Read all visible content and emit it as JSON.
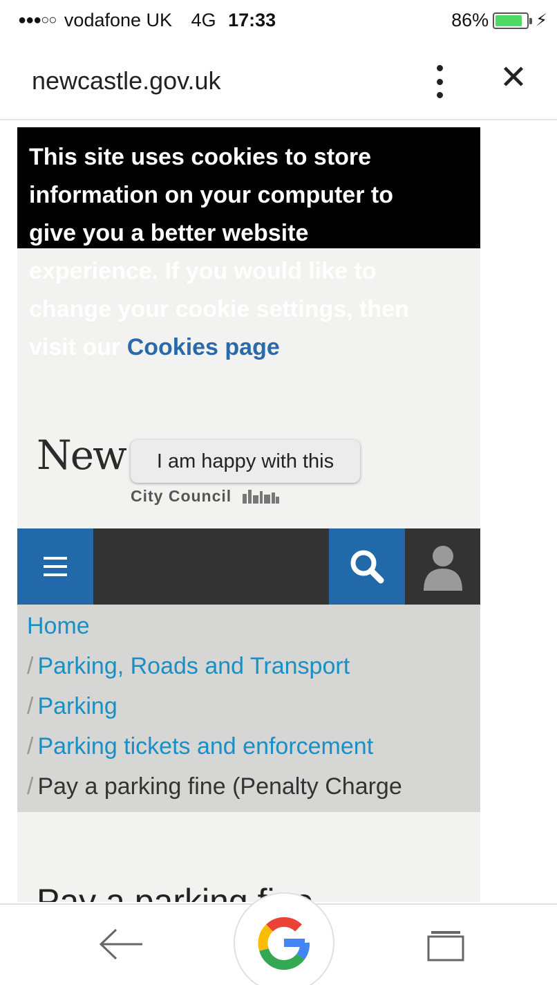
{
  "status_bar": {
    "signal": "●●●○○",
    "carrier": "vodafone UK",
    "network": "4G",
    "time": "17:33",
    "battery": "86%",
    "battery_level": 0.86,
    "battery_color": "#4cd964"
  },
  "browser": {
    "url": "newcastle.gov.uk",
    "menu_icon": "vertical-dots-icon",
    "close_icon": "close-icon"
  },
  "cookie_banner": {
    "text": "This site uses cookies to store information on your computer to give you a better website experience. If you would like to change your cookie settings, then visit our",
    "link": "Cookies page",
    "accept_button": "I am happy with this"
  },
  "logo": {
    "text_partial": "New",
    "subtitle": "City Council"
  },
  "navbar": {
    "menu_icon": "hamburger-icon",
    "search_icon": "search-icon",
    "user_icon": "user-icon",
    "accent_color": "#2169a8"
  },
  "breadcrumb": {
    "separator": "/",
    "items": [
      {
        "label": "Home"
      },
      {
        "label": "Parking, Roads and Transport"
      },
      {
        "label": "Parking"
      },
      {
        "label": "Parking tickets and enforcement"
      },
      {
        "label": "Pay a parking fine (Penalty Charge"
      }
    ]
  },
  "page": {
    "heading": "Pay a parking fine"
  },
  "bottom_bar": {
    "back_icon": "back-arrow-icon",
    "google_icon": "google-icon",
    "tabs_icon": "tabs-icon"
  }
}
